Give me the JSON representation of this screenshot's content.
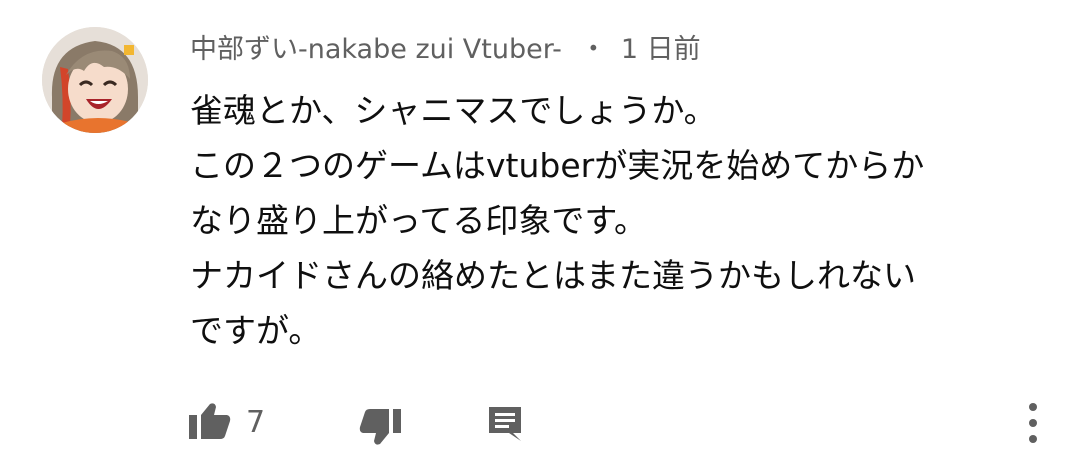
{
  "comment": {
    "author": "中部ずい-nakabe zui Vtuber-",
    "separator": "・",
    "timestamp": "1 日前",
    "lines": [
      "雀魂とか、シャニマスでしょうか。",
      "この２つのゲームはvtuberが実況を始めてからか",
      "なり盛り上がってる印象です。",
      "ナカイドさんの絡めたとはまた違うかもしれない",
      "ですが。"
    ],
    "like_count": "7"
  },
  "icons": {
    "avatar": "avatar",
    "like": "thumbs-up-icon",
    "dislike": "thumbs-down-icon",
    "reply": "reply-comment-icon",
    "more": "more-vertical-icon"
  },
  "colors": {
    "meta": "#606060",
    "text": "#0f0f0f",
    "icon": "#606060",
    "background": "#ffffff"
  }
}
